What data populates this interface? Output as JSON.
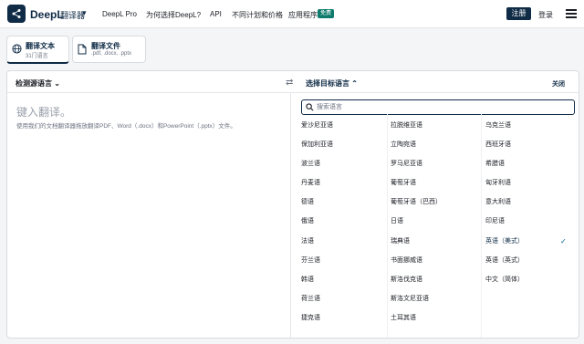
{
  "header": {
    "brand": "DeepL",
    "brand_sub": "翻译器",
    "nav": [
      {
        "label": "DeepL Pro"
      },
      {
        "label": "为何选择DeepL?"
      },
      {
        "label": "API"
      },
      {
        "label": "不同计划和价格"
      },
      {
        "label": "应用程序"
      }
    ],
    "badge": "免费",
    "register": "注册",
    "login": "登录"
  },
  "tabs": [
    {
      "title": "翻译文本",
      "subtitle": "31门语言"
    },
    {
      "title": "翻译文件",
      "subtitle": ".pdf, .docx, .pptx"
    }
  ],
  "source": {
    "header": "检测源语言",
    "placeholder": "键入翻译。",
    "hint": "使用我们的文档翻译器拖放翻译PDF、Word（.docx）和PowerPoint（.pptx）文件。"
  },
  "target": {
    "header": "选择目标语言",
    "close": "关闭",
    "search_placeholder": "搜索语言",
    "columns": [
      [
        "爱沙尼亚语",
        "保加利亚语",
        "波兰语",
        "丹麦语",
        "德语",
        "俄语",
        "法语",
        "芬兰语",
        "韩语",
        "荷兰语",
        "捷克语"
      ],
      [
        "拉脱维亚语",
        "立陶宛语",
        "罗马尼亚语",
        "葡萄牙语",
        "葡萄牙语（巴西）",
        "日语",
        "瑞典语",
        "书面挪威语",
        "斯洛伐克语",
        "斯洛文尼亚语",
        "土耳其语"
      ],
      [
        "乌克兰语",
        "西班牙语",
        "希腊语",
        "匈牙利语",
        "意大利语",
        "印尼语",
        "英语（美式）",
        "英语（英式）",
        "中文（简体）"
      ]
    ],
    "selected": "英语（美式）"
  },
  "colors": {
    "brand": "#0f2b46",
    "accent": "#006494",
    "badge": "#0f7b6c"
  }
}
